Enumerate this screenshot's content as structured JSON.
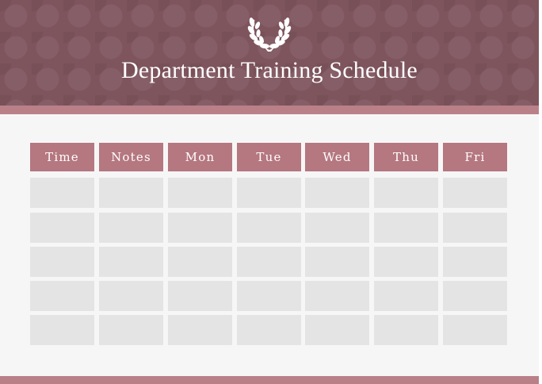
{
  "header": {
    "title": "Department Training Schedule",
    "emblem": "laurel-wreath-icon"
  },
  "schedule": {
    "columns": [
      "Time",
      "Notes",
      "Mon",
      "Tue",
      "Wed",
      "Thu",
      "Fri"
    ],
    "rows": [
      [
        "",
        "",
        "",
        "",
        "",
        "",
        ""
      ],
      [
        "",
        "",
        "",
        "",
        "",
        "",
        ""
      ],
      [
        "",
        "",
        "",
        "",
        "",
        "",
        ""
      ],
      [
        "",
        "",
        "",
        "",
        "",
        "",
        ""
      ],
      [
        "",
        "",
        "",
        "",
        "",
        "",
        ""
      ]
    ]
  },
  "colors": {
    "header_background": "#7e545d",
    "accent": "#b57780",
    "cell": "#e4e4e4",
    "panel": "#f7f6f6"
  }
}
